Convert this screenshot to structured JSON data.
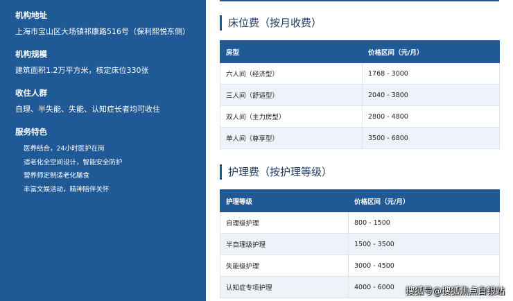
{
  "sidebar": {
    "address_label": "机构地址",
    "address_value": "上海市宝山区大场镇祁康路516号（保利熙悦东侧）",
    "scale_label": "机构规模",
    "scale_value": "建筑面积1.2万平方米，核定床位330张",
    "intake_label": "收住人群",
    "intake_value": "自理、半失能、失能、认知症长者均可收住",
    "features_label": "服务特色",
    "features": [
      "医养结合，24小时医护在岗",
      "适老化全空间设计，智能安全防护",
      "营养师定制适老化膳食",
      "丰富文娱活动，精神陪伴关怀"
    ]
  },
  "bed_section": {
    "title": "床位费（按月收费）",
    "columns": [
      "房型",
      "价格区间（元/月）"
    ],
    "rows": [
      [
        "六人间（经济型）",
        "1768 - 3000"
      ],
      [
        "三人间（舒适型）",
        "2040 - 3800"
      ],
      [
        "双人间（主力房型）",
        "2800 - 4800"
      ],
      [
        "单人间（尊享型）",
        "3500 - 6800"
      ]
    ]
  },
  "care_section": {
    "title": "护理费（按护理等级）",
    "columns": [
      "护理等级",
      "价格区间（元/月）"
    ],
    "rows": [
      [
        "自理级护理",
        "800 - 1500"
      ],
      [
        "半自理级护理",
        "1500 - 3500"
      ],
      [
        "失能级护理",
        "3000 - 4500"
      ],
      [
        "认知症专项护理",
        "4000 - 6000"
      ]
    ]
  },
  "watermark": "搜狐号@搜狐焦点白银站"
}
